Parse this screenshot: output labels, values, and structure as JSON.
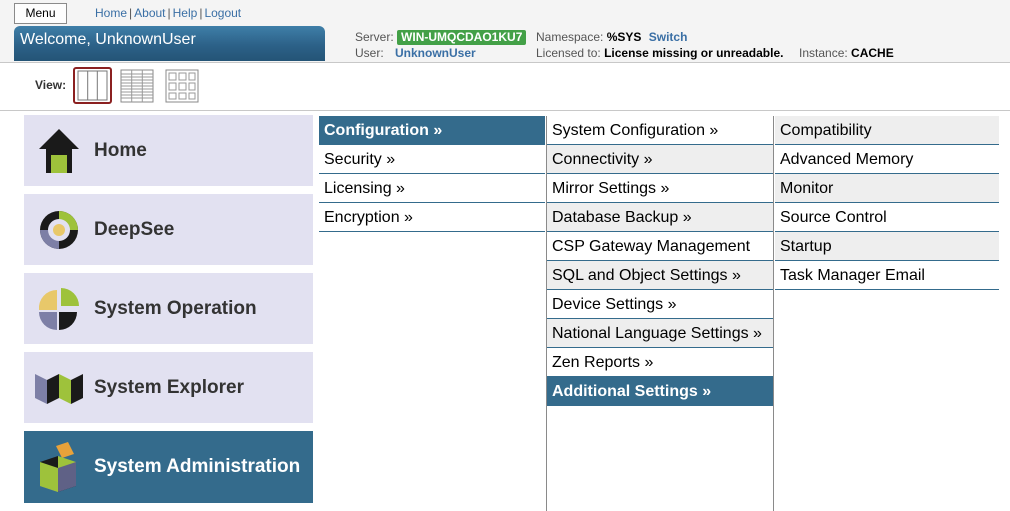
{
  "header": {
    "menu_label": "Menu",
    "links": [
      "Home",
      "About",
      "Help",
      "Logout"
    ],
    "link_sep": "|",
    "welcome": "Welcome, UnknownUser",
    "server_label": "Server:",
    "server_value": "WIN-UMQCDAO1KU7",
    "namespace_label": "Namespace:",
    "namespace_value": "%SYS",
    "switch_label": "Switch",
    "user_label": "User:",
    "user_value": "UnknownUser",
    "licensed_label": "Licensed to:",
    "licensed_value": "License missing or unreadable.",
    "instance_label": "Instance:",
    "instance_value": "CACHE"
  },
  "view": {
    "label": "View:",
    "options": [
      "columns-view-icon",
      "list-view-icon",
      "grid-view-icon"
    ],
    "active": "columns-view-icon"
  },
  "tiles": [
    {
      "label": "Home",
      "icon": "house-icon"
    },
    {
      "label": "DeepSee",
      "icon": "deepsee-icon"
    },
    {
      "label": "System Operation",
      "icon": "pie-quadrant-icon"
    },
    {
      "label": "System Explorer",
      "icon": "explorer-folds-icon"
    },
    {
      "label": "System Administration",
      "icon": "open-box-icon",
      "selected": true
    }
  ],
  "columns": {
    "col1": [
      {
        "label": "Configuration »",
        "selected": true
      },
      {
        "label": "Security »"
      },
      {
        "label": "Licensing »"
      },
      {
        "label": "Encryption »"
      }
    ],
    "col2": [
      {
        "label": "System Configuration »"
      },
      {
        "label": "Connectivity »"
      },
      {
        "label": "Mirror Settings »"
      },
      {
        "label": "Database Backup »"
      },
      {
        "label": "CSP Gateway Management"
      },
      {
        "label": "SQL and Object Settings »"
      },
      {
        "label": "Device Settings »"
      },
      {
        "label": "National Language Settings »"
      },
      {
        "label": "Zen Reports »"
      },
      {
        "label": "Additional Settings »",
        "selected": true
      }
    ],
    "col3": [
      {
        "label": "Compatibility"
      },
      {
        "label": "Advanced Memory"
      },
      {
        "label": "Monitor"
      },
      {
        "label": "Source Control"
      },
      {
        "label": "Startup"
      },
      {
        "label": "Task Manager Email"
      }
    ]
  },
  "colors": {
    "accent": "#346b8c",
    "tile_bg": "#e2e1f1",
    "server_badge": "#43a047",
    "link": "#3a6fa5"
  }
}
